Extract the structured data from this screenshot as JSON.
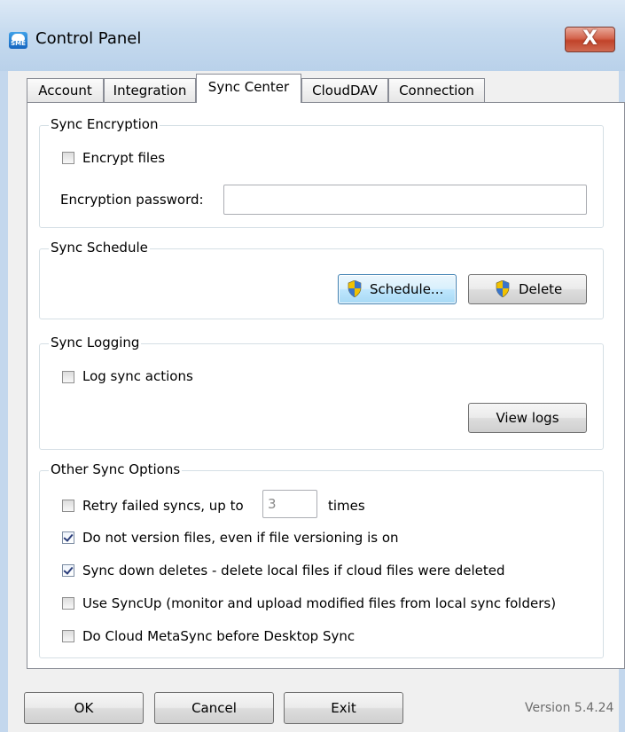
{
  "window": {
    "title": "Control Panel",
    "close_label": "X"
  },
  "tabs": [
    {
      "label": "Account",
      "active": false
    },
    {
      "label": "Integration",
      "active": false
    },
    {
      "label": "Sync Center",
      "active": true
    },
    {
      "label": "CloudDAV",
      "active": false
    },
    {
      "label": "Connection",
      "active": false
    }
  ],
  "encryption": {
    "title": "Sync Encryption",
    "encrypt_label": "Encrypt files",
    "encrypt_checked": false,
    "password_label": "Encryption password:",
    "password_value": ""
  },
  "schedule": {
    "title": "Sync Schedule",
    "schedule_button": "Schedule...",
    "delete_button": "Delete"
  },
  "logging": {
    "title": "Sync Logging",
    "log_label": "Log sync actions",
    "log_checked": false,
    "view_logs_button": "View logs"
  },
  "other": {
    "title": "Other Sync Options",
    "retry_label": "Retry failed syncs, up to",
    "retry_checked": false,
    "retry_value": "3",
    "retry_suffix": "times",
    "no_version_label": "Do not version files, even if file versioning is on",
    "no_version_checked": true,
    "sync_deletes_label": "Sync down deletes - delete local files if cloud files were deleted",
    "sync_deletes_checked": true,
    "syncup_label": "Use SyncUp (monitor and upload modified files from local sync folders)",
    "syncup_checked": false,
    "metasync_label": "Do Cloud MetaSync before Desktop Sync",
    "metasync_checked": false
  },
  "footer": {
    "ok": "OK",
    "cancel": "Cancel",
    "exit": "Exit",
    "version": "Version 5.4.24"
  },
  "colors": {
    "title_bar": "#c7dbef",
    "close_button": "#c1432a",
    "focused_button": "#bee6fd"
  }
}
